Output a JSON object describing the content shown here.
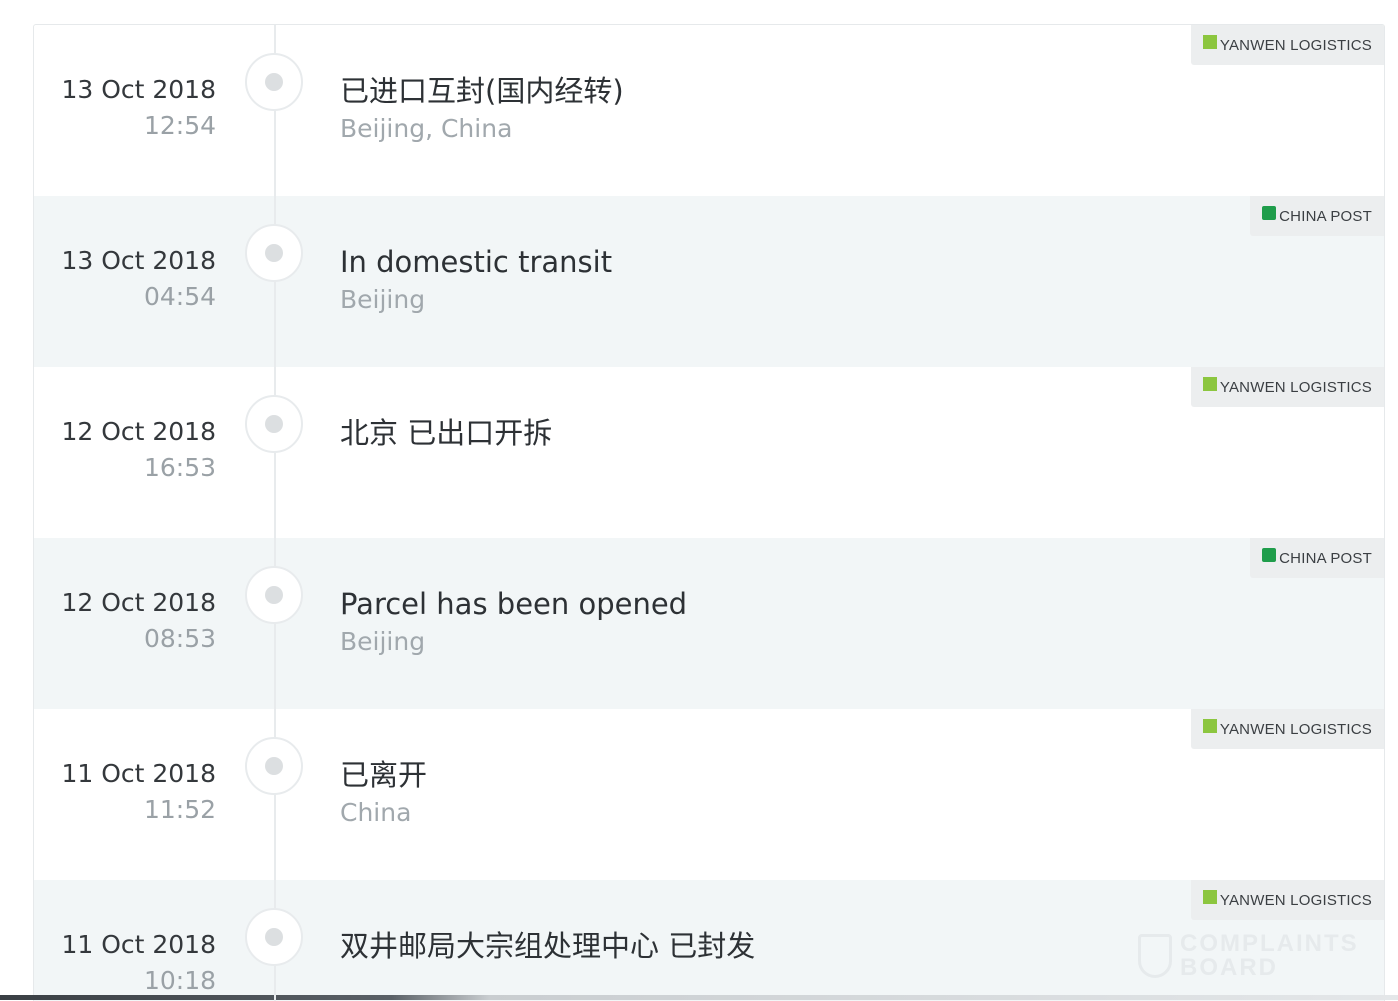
{
  "events": [
    {
      "date": "13 Oct 2018",
      "time": "12:54",
      "status": "已进口互封(国内经转)",
      "location": "Beijing, China",
      "carrier": "YANWEN LOGISTICS",
      "carrier_icon": "yanwen-logo-icon"
    },
    {
      "date": "13 Oct 2018",
      "time": "04:54",
      "status": "In domestic transit",
      "location": "Beijing",
      "carrier": "CHINA POST",
      "carrier_icon": "china-post-logo-icon"
    },
    {
      "date": "12 Oct 2018",
      "time": "16:53",
      "status": "北京 已出口开拆",
      "location": "",
      "carrier": "YANWEN LOGISTICS",
      "carrier_icon": "yanwen-logo-icon"
    },
    {
      "date": "12 Oct 2018",
      "time": "08:53",
      "status": "Parcel has been opened",
      "location": "Beijing",
      "carrier": "CHINA POST",
      "carrier_icon": "china-post-logo-icon"
    },
    {
      "date": "11 Oct 2018",
      "time": "11:52",
      "status": "已离开",
      "location": "China",
      "carrier": "YANWEN LOGISTICS",
      "carrier_icon": "yanwen-logo-icon"
    },
    {
      "date": "11 Oct 2018",
      "time": "10:18",
      "status": "双井邮局大宗组处理中心 已封发",
      "location": "",
      "carrier": "YANWEN LOGISTICS",
      "carrier_icon": "yanwen-logo-icon"
    }
  ],
  "watermark": {
    "line1": "COMPLAINTS",
    "line2": "BOARD"
  },
  "colors": {
    "shaded_row": "#f2f6f7",
    "yanwen_green": "#8cc63f",
    "china_post_green": "#1f9d4b",
    "location_gray": "#a1a8ad"
  }
}
